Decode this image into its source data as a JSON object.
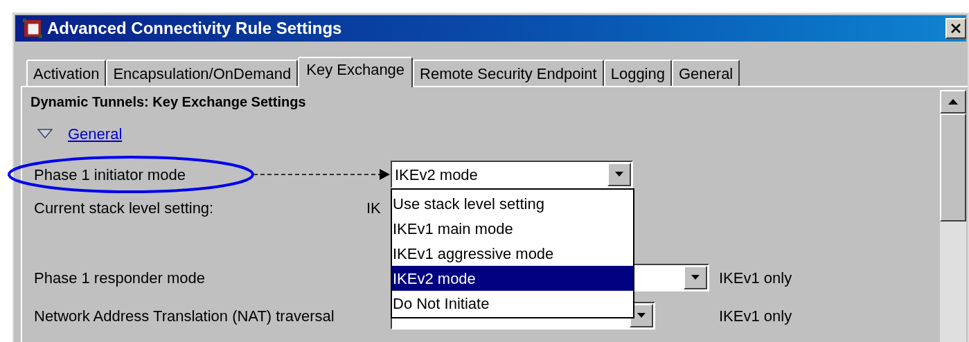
{
  "window": {
    "title": "Advanced Connectivity Rule Settings"
  },
  "tabs": [
    {
      "label": "Activation",
      "selected": false
    },
    {
      "label": "Encapsulation/OnDemand",
      "selected": false
    },
    {
      "label": "Key Exchange",
      "selected": true
    },
    {
      "label": "Remote Security Endpoint",
      "selected": false
    },
    {
      "label": "Logging",
      "selected": false
    },
    {
      "label": "General",
      "selected": false
    }
  ],
  "panel": {
    "heading": "Dynamic Tunnels: Key Exchange Settings",
    "section": {
      "title": "General",
      "expanded": true
    }
  },
  "initiator": {
    "label": "Phase 1 initiator mode",
    "annotated": true,
    "value": "IKEv2 mode",
    "open": true,
    "options": [
      {
        "label": "Use stack level setting",
        "selected": false
      },
      {
        "label": "IKEv1 main mode",
        "selected": false
      },
      {
        "label": "IKEv1 aggressive mode",
        "selected": false
      },
      {
        "label": "IKEv2 mode",
        "selected": true
      },
      {
        "label": "Do Not Initiate",
        "selected": false
      }
    ]
  },
  "stack_level": {
    "label": "Current stack level setting:",
    "value": "IK"
  },
  "responder": {
    "label": "Phase 1 responder mode",
    "note": "IKEv1 only"
  },
  "nat": {
    "label": "Network Address Translation (NAT) traversal",
    "note": "IKEv1 only"
  }
}
